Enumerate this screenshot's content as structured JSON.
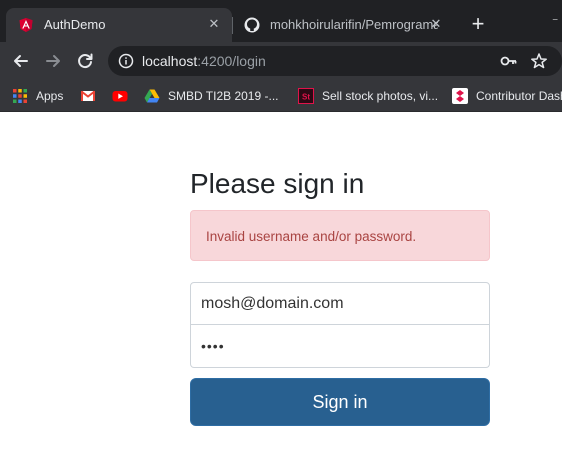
{
  "browser": {
    "tabs": [
      {
        "title": "AuthDemo",
        "icon": "angular-icon",
        "active": true
      },
      {
        "title": "mohkhoirularifin/Pemrograma",
        "icon": "github-icon",
        "active": false
      }
    ],
    "new_tab_label": "+",
    "close_glyph": "✕",
    "address": {
      "host": "localhost",
      "path": ":4200/login"
    },
    "bookmarks": [
      {
        "label": "Apps",
        "icon": "apps-grid-icon"
      },
      {
        "label": "",
        "icon": "gmail-icon"
      },
      {
        "label": "",
        "icon": "youtube-icon"
      },
      {
        "label": "SMBD TI2B 2019 -...",
        "icon": "google-drive-icon"
      },
      {
        "label": "Sell stock photos, vi...",
        "icon": "shutterstock-icon"
      },
      {
        "label": "Contributor Dash",
        "icon": "contributor-icon"
      }
    ]
  },
  "login": {
    "heading": "Please sign in",
    "error": "Invalid username and/or password.",
    "email_value": "mosh@domain.com",
    "password_value": "••••",
    "submit_label": "Sign in"
  },
  "colors": {
    "chrome_dark": "#202124",
    "chrome_toolbar": "#35363a",
    "alert_bg": "#f8d7da",
    "alert_text": "#a94442",
    "button_bg": "#286090"
  }
}
